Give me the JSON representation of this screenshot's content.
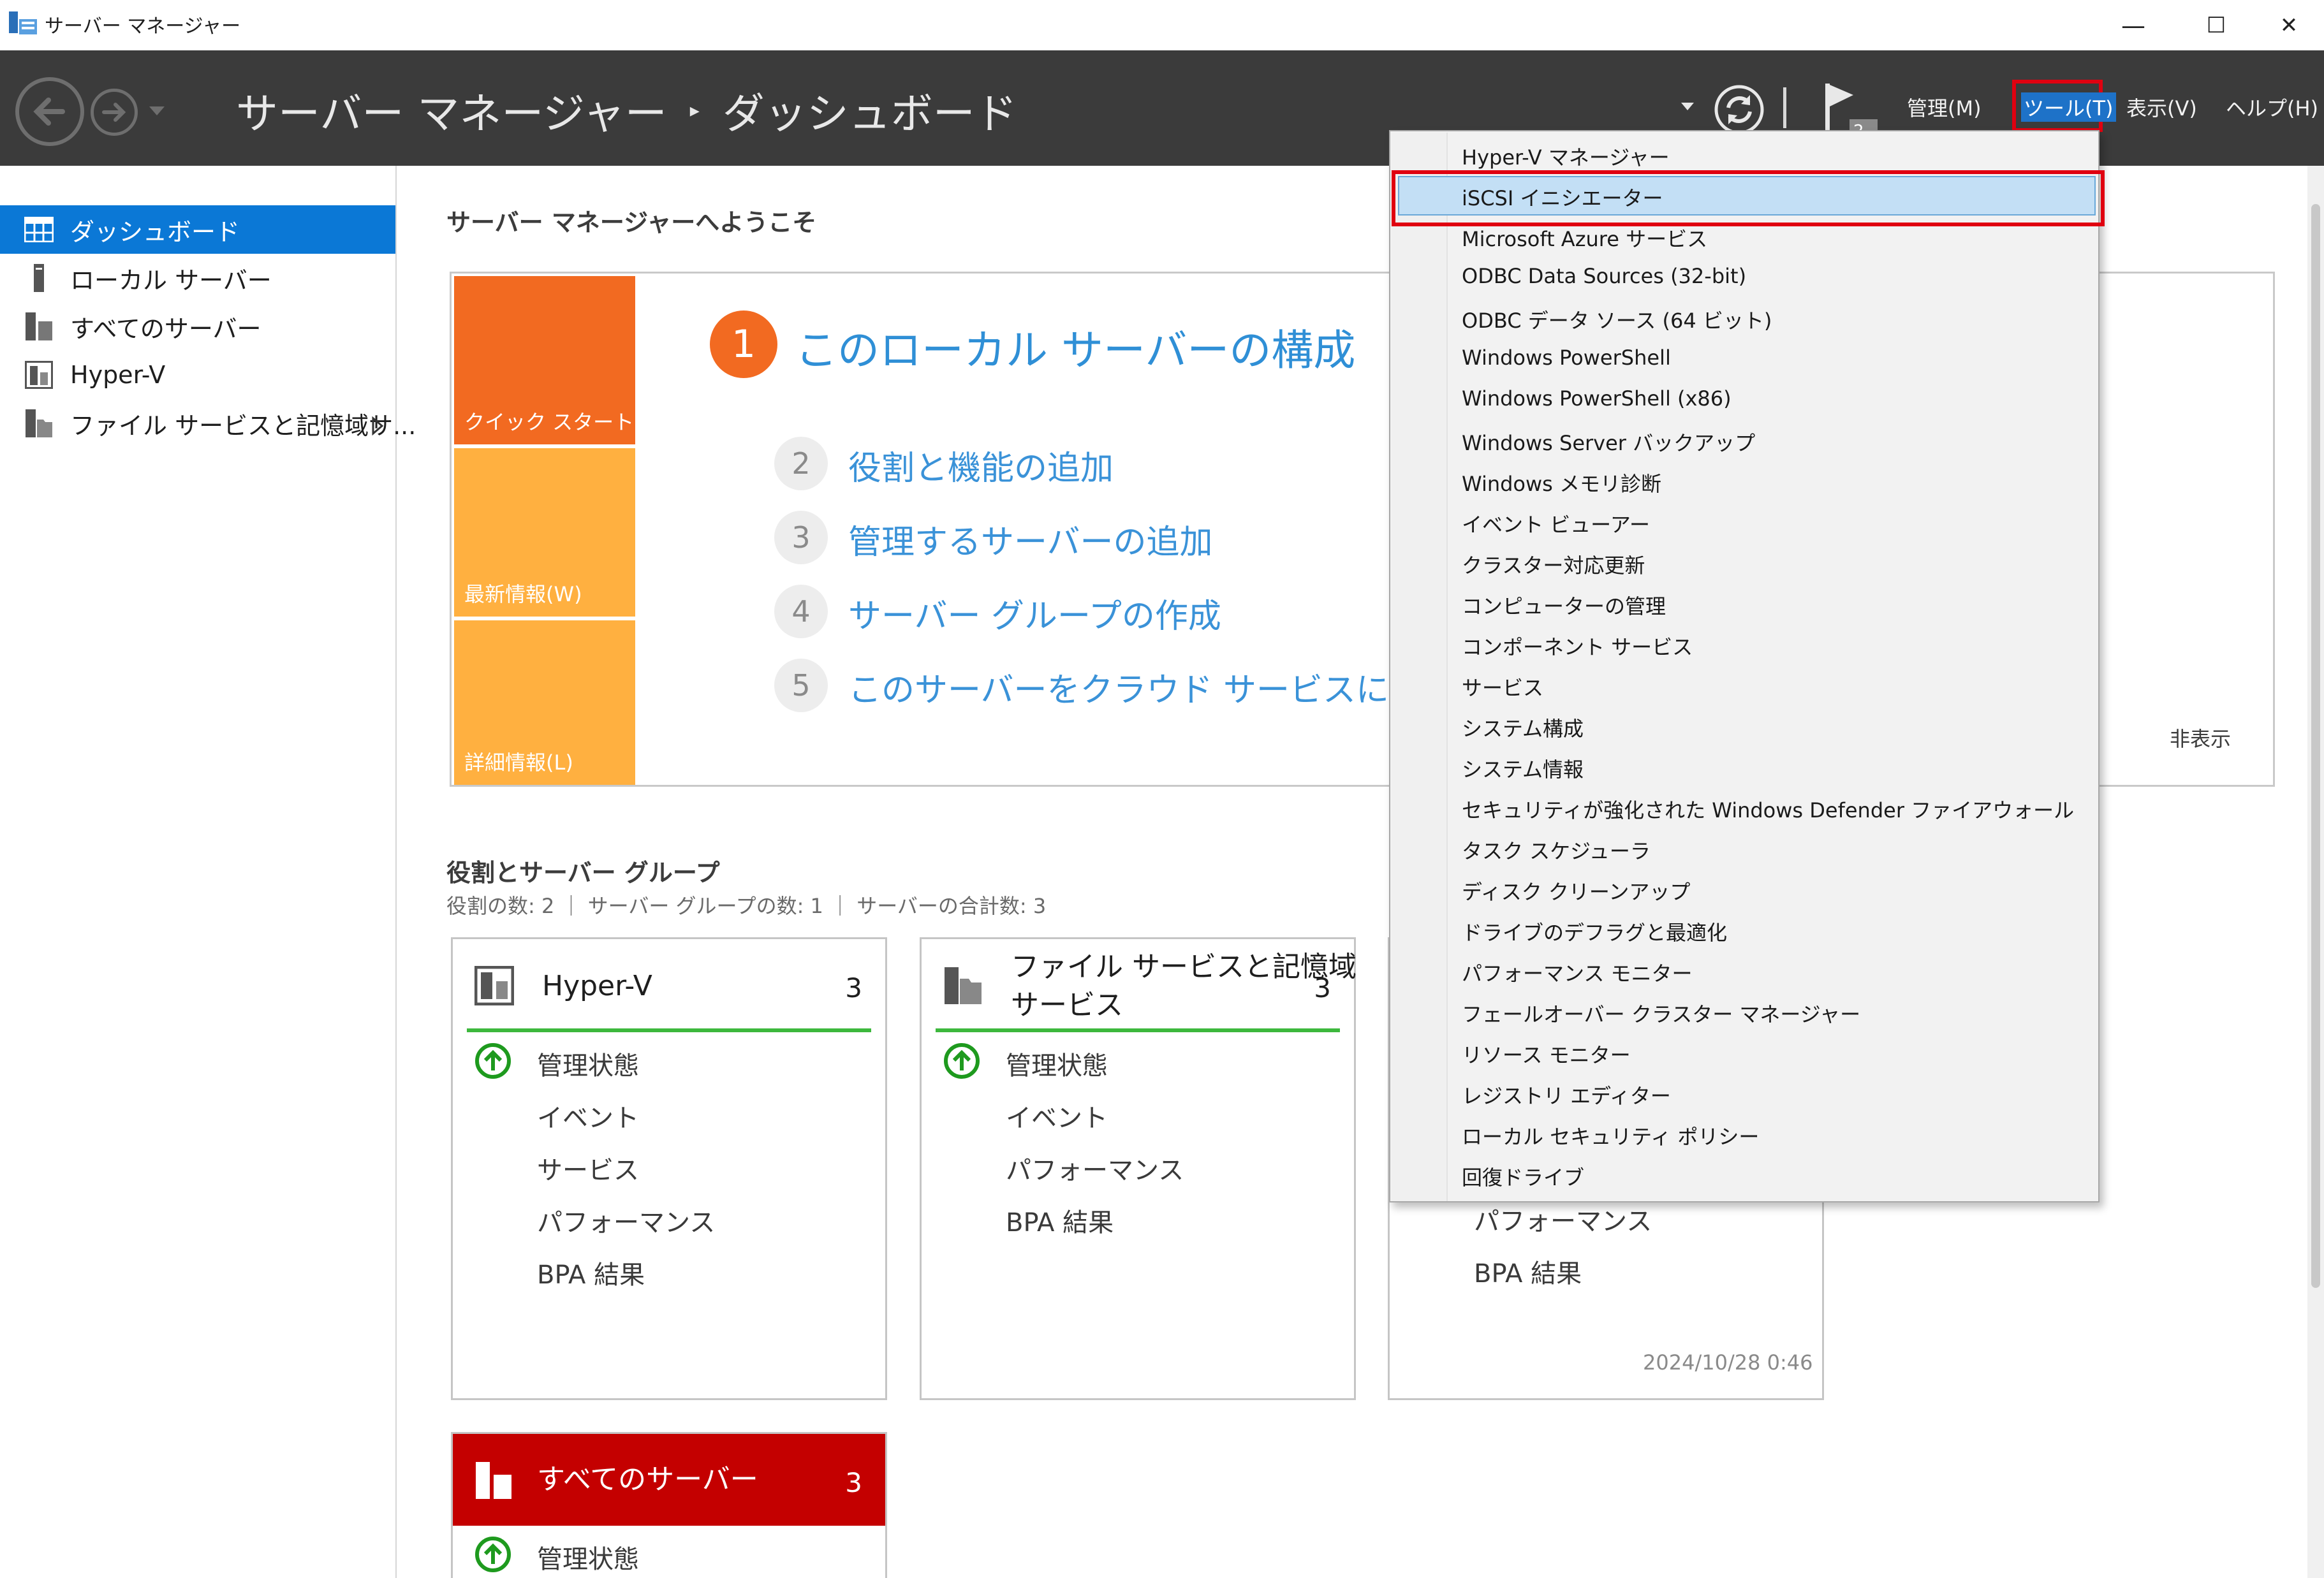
{
  "window": {
    "title": "サーバー マネージャー",
    "minimize": "—",
    "maximize": "☐",
    "close": "✕"
  },
  "header": {
    "breadcrumb_root": "サーバー マネージャー",
    "breadcrumb_separator": "▸",
    "breadcrumb_current": "ダッシュボード",
    "notification_count": "2",
    "menus": {
      "manage": "管理(M)",
      "tools": "ツール(T)",
      "view": "表示(V)",
      "help": "ヘルプ(H)"
    }
  },
  "sidebar": {
    "items": [
      {
        "label": "ダッシュボード",
        "icon": "dashboard-icon"
      },
      {
        "label": "ローカル サーバー",
        "icon": "local-server-icon"
      },
      {
        "label": "すべてのサーバー",
        "icon": "all-servers-icon"
      },
      {
        "label": "Hyper-V",
        "icon": "hyperv-icon"
      },
      {
        "label": "ファイル サービスと記憶域サ...",
        "icon": "file-services-icon"
      }
    ]
  },
  "welcome": {
    "title": "サーバー マネージャーへようこそ",
    "tiles": [
      "クイック スタート(Q)",
      "最新情報(W)",
      "詳細情報(L)"
    ],
    "main_step": {
      "num": "1",
      "text": "このローカル サーバーの構成"
    },
    "steps": [
      {
        "num": "2",
        "text": "役割と機能の追加"
      },
      {
        "num": "3",
        "text": "管理するサーバーの追加"
      },
      {
        "num": "4",
        "text": "サーバー グループの作成"
      },
      {
        "num": "5",
        "text": "このサーバーをクラウド サービスに接続する"
      }
    ],
    "hide": "非表示"
  },
  "roles": {
    "title": "役割とサーバー グループ",
    "summary": "役割の数: 2 ｜ サーバー グループの数: 1 ｜ サーバーの合計数: 3",
    "cards": [
      {
        "title": "Hyper-V",
        "count": "3",
        "rows": [
          "管理状態",
          "イベント",
          "サービス",
          "パフォーマンス",
          "BPA 結果"
        ]
      },
      {
        "title_line1": "ファイル サービスと記憶域",
        "title_line2": "サービス",
        "count": "3",
        "rows": [
          "管理状態",
          "イベント",
          "パフォーマンス",
          "BPA 結果"
        ]
      },
      {
        "rows": [
          "パフォーマンス",
          "BPA 結果"
        ],
        "timestamp": "2024/10/28 0:46"
      },
      {
        "title": "すべてのサーバー",
        "count": "3",
        "rows": [
          "管理状態"
        ]
      }
    ]
  },
  "tools_menu": {
    "items": [
      "Hyper-V マネージャー",
      "iSCSI イニシエーター",
      "Microsoft Azure サービス",
      "ODBC Data Sources (32-bit)",
      "ODBC データ ソース (64 ビット)",
      "Windows PowerShell",
      "Windows PowerShell (x86)",
      "Windows Server バックアップ",
      "Windows メモリ診断",
      "イベント ビューアー",
      "クラスター対応更新",
      "コンピューターの管理",
      "コンポーネント サービス",
      "サービス",
      "システム構成",
      "システム情報",
      "セキュリティが強化された Windows Defender ファイアウォール",
      "タスク スケジューラ",
      "ディスク クリーンアップ",
      "ドライブのデフラグと最適化",
      "パフォーマンス モニター",
      "フェールオーバー クラスター マネージャー",
      "リソース モニター",
      "レジストリ エディター",
      "ローカル セキュリティ ポリシー",
      "回復ドライブ"
    ],
    "highlighted_index": 1
  },
  "colors": {
    "header_bg": "#3b3b3b",
    "accent_blue": "#0b78d6",
    "quick_start_orange": "#f26a21",
    "tile_orange": "#ffb040",
    "ok_green": "#3db83d",
    "alert_red": "#c40000",
    "highlight_red": "#e00010"
  }
}
